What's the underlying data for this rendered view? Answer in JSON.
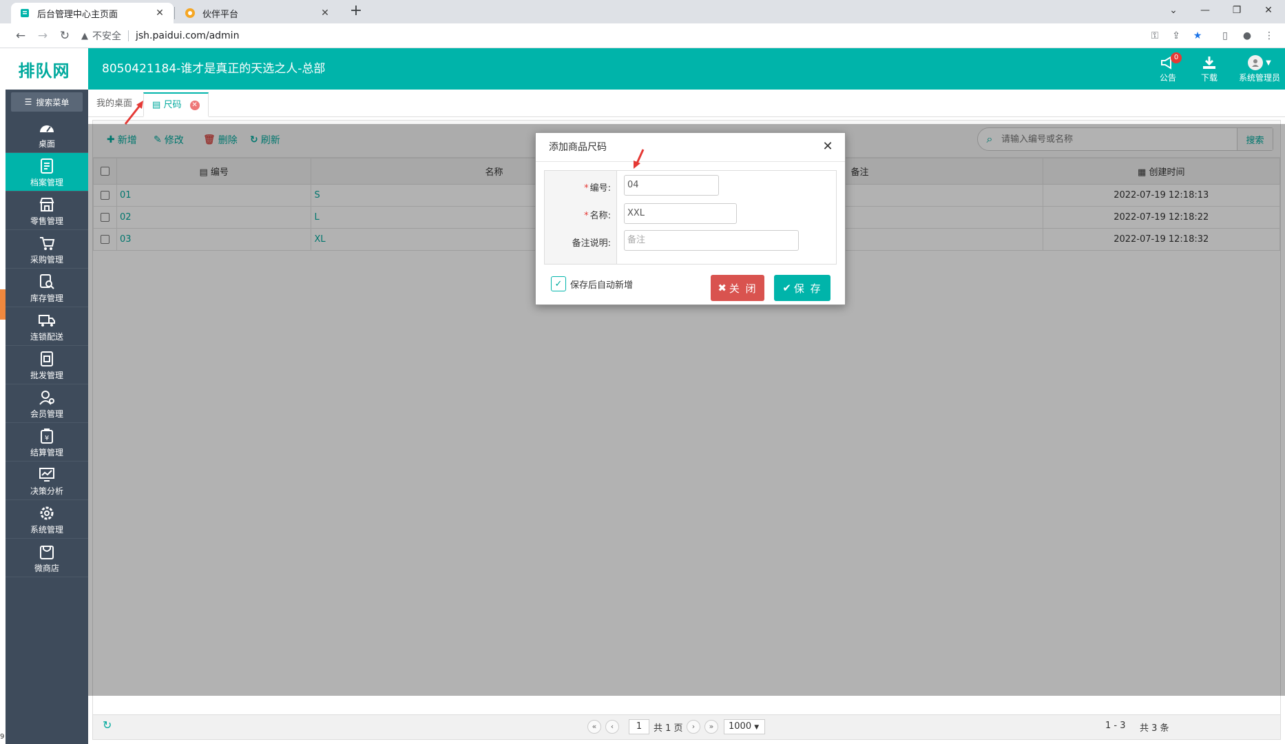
{
  "browser": {
    "tabs": [
      {
        "title": "后台管理中心主页面",
        "active": true
      },
      {
        "title": "伙伴平台",
        "active": false
      }
    ],
    "insecure_label": "不安全",
    "url": "jsh.paidui.com/admin"
  },
  "app": {
    "logo": "排队网",
    "title": "8050421184-谁才是真正的天选之人-总部",
    "header": {
      "notice_label": "公告",
      "notice_badge": "0",
      "download_label": "下载",
      "user_label": "系统管理员"
    }
  },
  "sidebar": {
    "search_label": "搜索菜单",
    "items": [
      {
        "label": "桌面",
        "icon": "dashboard-icon"
      },
      {
        "label": "档案管理",
        "icon": "archive-icon",
        "active": true
      },
      {
        "label": "零售管理",
        "icon": "store-icon"
      },
      {
        "label": "采购管理",
        "icon": "cart-icon"
      },
      {
        "label": "库存管理",
        "icon": "inventory-icon"
      },
      {
        "label": "连锁配送",
        "icon": "truck-icon"
      },
      {
        "label": "批发管理",
        "icon": "wholesale-icon"
      },
      {
        "label": "会员管理",
        "icon": "member-icon"
      },
      {
        "label": "结算管理",
        "icon": "settlement-icon"
      },
      {
        "label": "决策分析",
        "icon": "analysis-icon"
      },
      {
        "label": "系统管理",
        "icon": "gear-icon"
      },
      {
        "label": "微商店",
        "icon": "shop-bag-icon"
      }
    ]
  },
  "page_tabs": {
    "desktop": "我的桌面",
    "size": "尺码"
  },
  "toolbar": {
    "add": "新增",
    "edit": "修改",
    "delete": "删除",
    "refresh": "刷新",
    "search_placeholder": "请输入编号或名称",
    "search_button": "搜索"
  },
  "grid": {
    "columns": {
      "code": "编号",
      "name": "名称",
      "remark": "备注",
      "created": "创建时间"
    },
    "rows": [
      {
        "code": "01",
        "name": "S",
        "remark": "",
        "created": "2022-07-19 12:18:13"
      },
      {
        "code": "02",
        "name": "L",
        "remark": "",
        "created": "2022-07-19 12:18:22"
      },
      {
        "code": "03",
        "name": "XL",
        "remark": "",
        "created": "2022-07-19 12:18:32"
      }
    ]
  },
  "pager": {
    "page": "1",
    "total_pages": "共 1 页",
    "page_size": "1000",
    "range": "1 - 3",
    "total": "共 3 条"
  },
  "modal": {
    "title": "添加商品尺码",
    "code_label": "编号:",
    "code_value": "04",
    "name_label": "名称:",
    "name_value": "XXL",
    "remark_label": "备注说明:",
    "remark_placeholder": "备注",
    "auto_add_label": "保存后自动新增",
    "close_button": "关 闭",
    "save_button": "保 存"
  },
  "colors": {
    "accent": "#00b4aa",
    "sidebar": "#3e4b5b",
    "danger": "#d9534f"
  },
  "misc": {
    "corner_digit": "9"
  }
}
